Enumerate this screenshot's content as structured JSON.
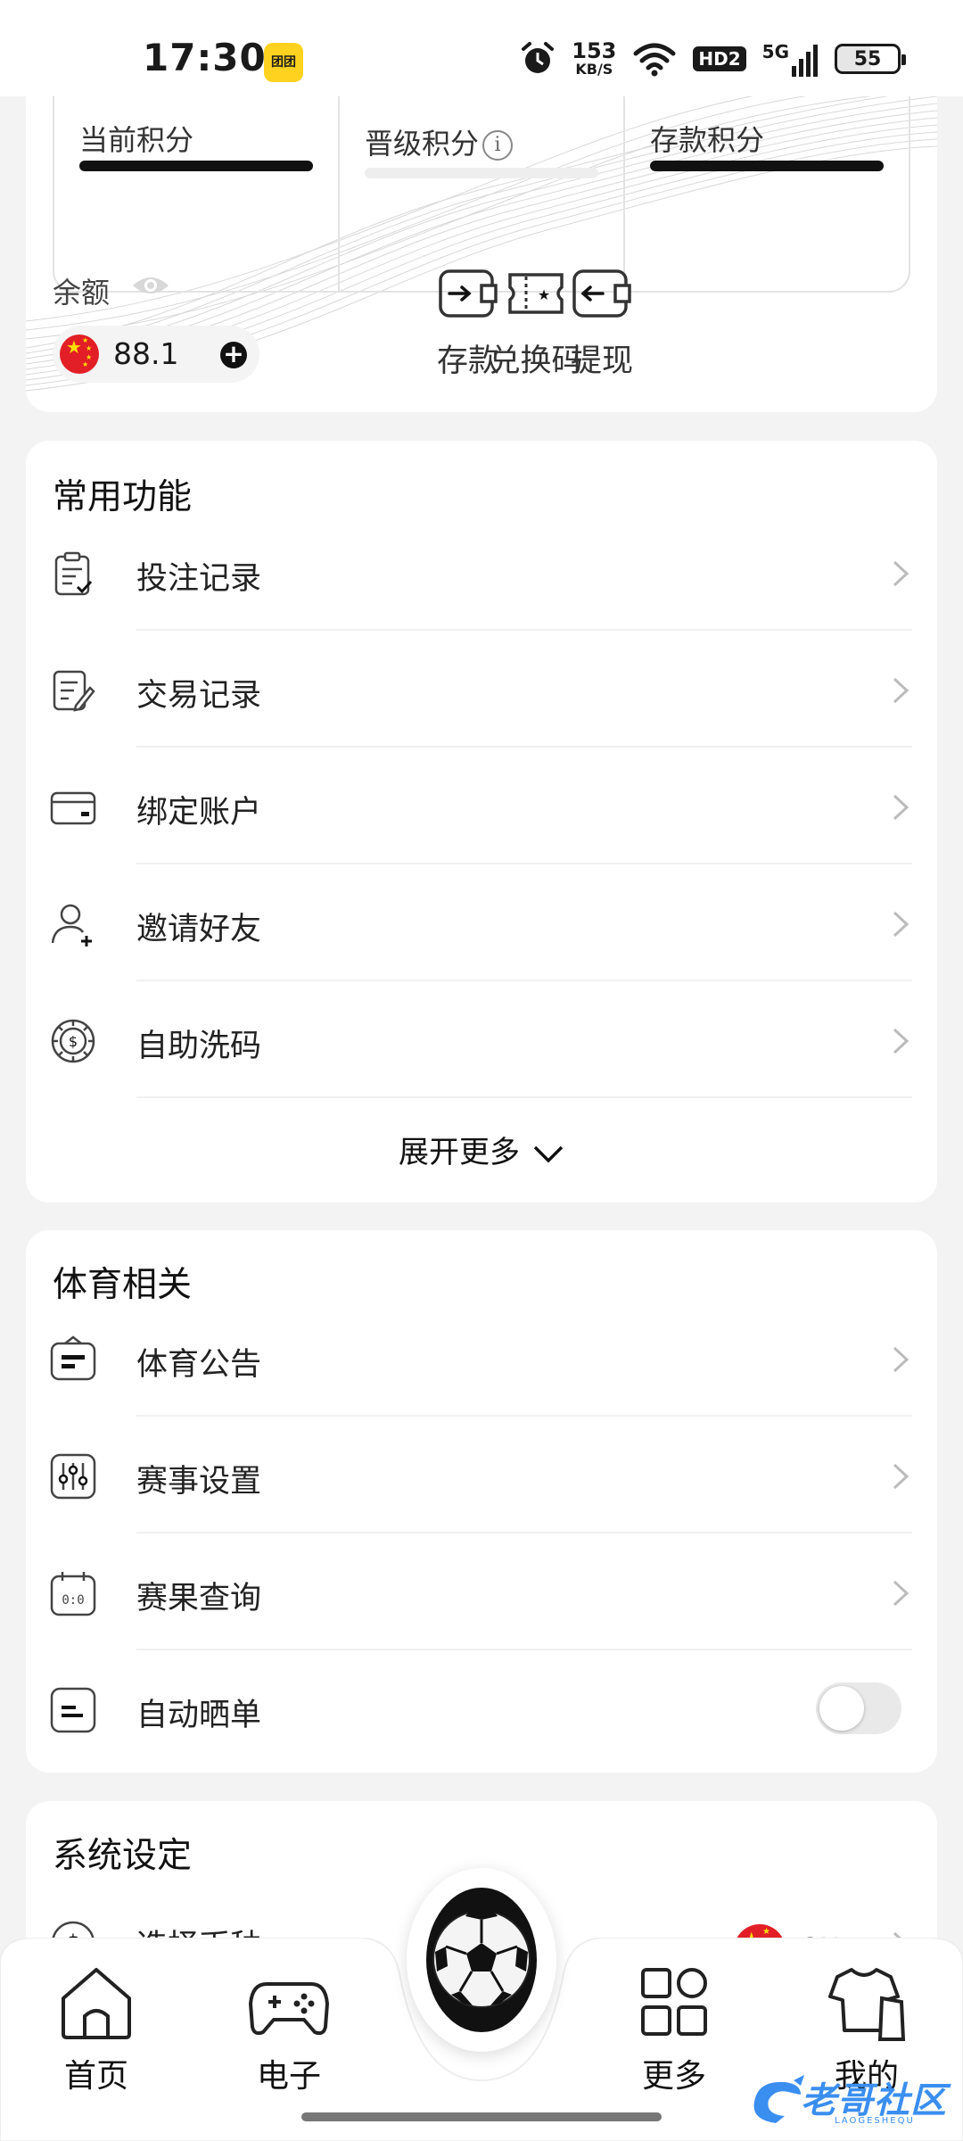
{
  "status_bar": {
    "time": "17:30",
    "app_icon_text": "团团",
    "net_speed_value": "153",
    "net_speed_unit": "KB/S",
    "hd_badge": "HD2",
    "network_type": "5G",
    "battery": "55"
  },
  "account": {
    "points": [
      {
        "label": "当前积分"
      },
      {
        "label": "晋级积分"
      },
      {
        "label": "存款积分"
      }
    ],
    "info_glyph": "i",
    "balance_label": "余额",
    "balance_value": "88.1",
    "actions": [
      {
        "label": "存款",
        "icon": "deposit-wallet-icon"
      },
      {
        "label": "兑换码",
        "icon": "redeem-ticket-icon"
      },
      {
        "label": "提现",
        "icon": "withdraw-wallet-icon"
      }
    ]
  },
  "common_functions": {
    "title": "常用功能",
    "items": [
      {
        "label": "投注记录",
        "icon": "bet-record-clipboard-icon"
      },
      {
        "label": "交易记录",
        "icon": "transaction-record-icon"
      },
      {
        "label": "绑定账户",
        "icon": "bank-card-icon"
      },
      {
        "label": "邀请好友",
        "icon": "invite-user-icon"
      },
      {
        "label": "自助洗码",
        "icon": "rebate-chip-icon"
      }
    ],
    "expand_label": "展开更多"
  },
  "sports": {
    "title": "体育相关",
    "items": [
      {
        "label": "体育公告",
        "icon": "announcement-icon"
      },
      {
        "label": "赛事设置",
        "icon": "settings-sliders-icon"
      },
      {
        "label": "赛果查询",
        "icon": "score-calendar-icon"
      },
      {
        "label": "自动晒单",
        "icon": "auto-share-icon",
        "toggle": false
      }
    ]
  },
  "system": {
    "title": "系统设定",
    "items": [
      {
        "label": "选择币种",
        "icon": "currency-dollar-icon",
        "value": "CNY"
      }
    ]
  },
  "bottom_nav": {
    "items": [
      {
        "label": "首页",
        "icon": "home-icon"
      },
      {
        "label": "电子",
        "icon": "gamepad-icon"
      },
      {
        "label": "更多",
        "icon": "grid-more-icon"
      },
      {
        "label": "我的",
        "icon": "profile-shirt-icon"
      }
    ],
    "center_icon": "soccer-ball-icon"
  },
  "watermark": {
    "text": "老哥社区",
    "sub": "LAOGESHEQU"
  },
  "colors": {
    "background": "#f3f3f4",
    "card": "#ffffff",
    "flag_red": "#e21f26",
    "flag_yellow": "#ffde00",
    "watermark_blue": "#3a8ef0"
  }
}
